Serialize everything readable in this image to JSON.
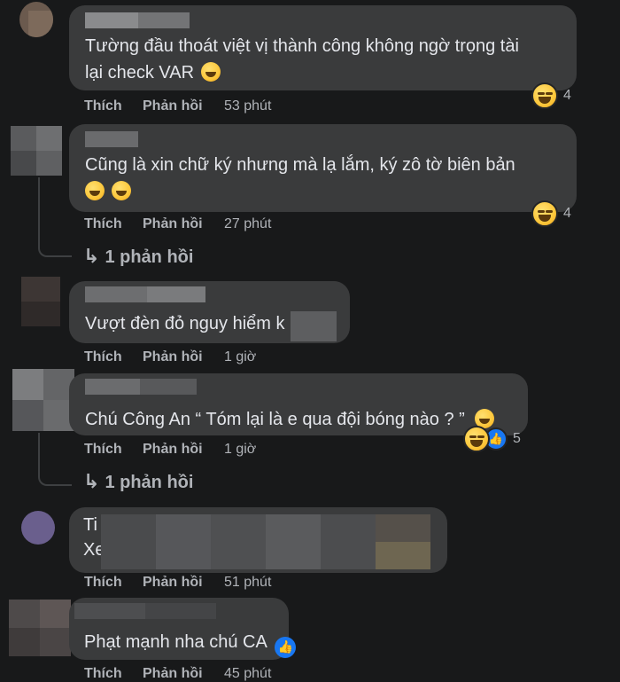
{
  "labels": {
    "like": "Thích",
    "reply": "Phản hồi"
  },
  "reply_count": {
    "arrow": "↳",
    "text": "1 phản hồi"
  },
  "comments": [
    {
      "lines": [
        "Tường đầu thoát việt vị thành công không ngờ trọng tài",
        "lại check VAR"
      ],
      "time": "53 phút",
      "reaction_count": "4"
    },
    {
      "lines": [
        "Cũng là xin chữ ký nhưng mà lạ lắm, ký zô tờ biên bản",
        ""
      ],
      "time": "27 phút",
      "reaction_count": "4"
    },
    {
      "lines": [
        "Vượt đèn đỏ nguy hiểm k"
      ],
      "time": "1 giờ"
    },
    {
      "lines": [
        "Chú Công An “ Tóm lại là e qua đội bóng nào ? ”"
      ],
      "time": "1 giờ",
      "reaction_count": "5"
    },
    {
      "lines": [
        "Ti",
        "Xe"
      ],
      "time": "51 phút"
    },
    {
      "lines": [
        "Phạt mạnh nha chú CA"
      ],
      "time": "45 phút"
    }
  ],
  "icons": {
    "laugh": "laughing-emoji-icon",
    "like": "like-reaction-icon",
    "reply_arrow": "reply-arrow-icon"
  },
  "colors": {
    "background": "#18191a",
    "bubble": "#3a3b3c",
    "text": "#e4e6eb",
    "muted": "#b0b3b8",
    "like_blue": "#1877f2"
  }
}
